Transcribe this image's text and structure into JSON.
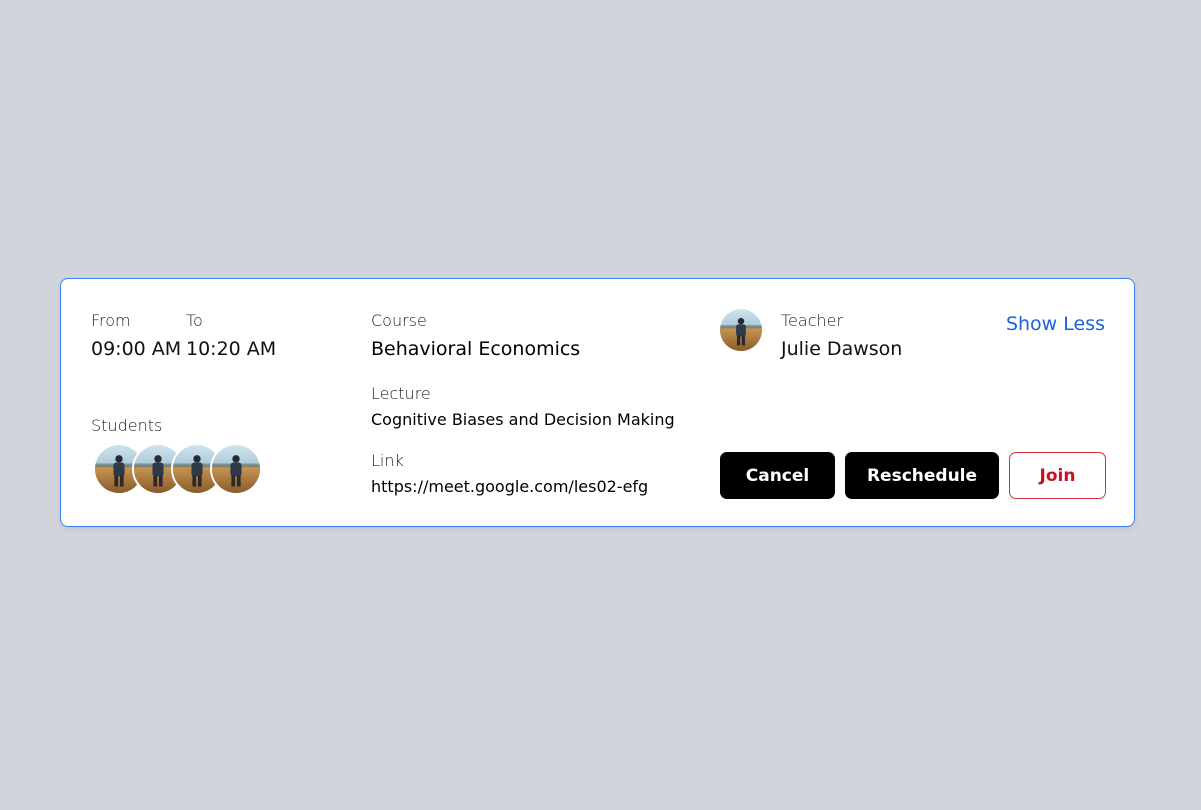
{
  "schedule": {
    "from_label": "From",
    "to_label": "To",
    "from_time": "09:00 AM",
    "to_time": "10:20 AM"
  },
  "students": {
    "label": "Students",
    "avatars": [
      "student-avatar",
      "student-avatar",
      "student-avatar",
      "student-avatar"
    ]
  },
  "course": {
    "label": "Course",
    "name": "Behavioral Economics"
  },
  "lecture": {
    "label": "Lecture",
    "name": "Cognitive Biases and Decision Making"
  },
  "link": {
    "label": "Link",
    "url": "https://meet.google.com/les02-efg"
  },
  "teacher": {
    "label": "Teacher",
    "name": "Julie Dawson"
  },
  "toggle_label": "Show Less",
  "actions": {
    "cancel_label": "Cancel",
    "reschedule_label": "Reschedule",
    "join_label": "Join"
  },
  "colors": {
    "background": "#d1d5db",
    "card_border": "#3b82f6",
    "link_blue": "#1d62d9",
    "join_red": "#c8101e",
    "button_dark": "#000000"
  }
}
